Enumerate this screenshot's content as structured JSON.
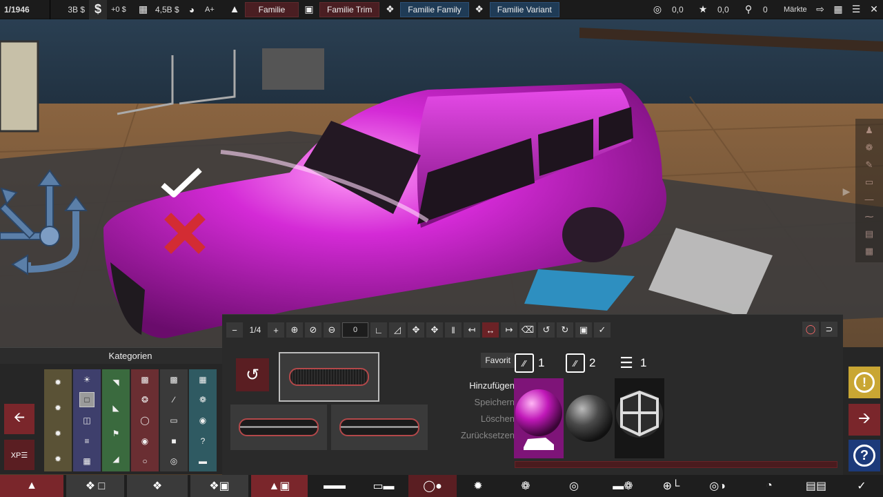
{
  "topbar": {
    "year": "1/1946",
    "money": "3B $",
    "money_icon": "dollar-icon",
    "delta": "+0 $",
    "cost": "4,5B $",
    "grade": "A+",
    "family_label": "Familie",
    "trim_label": "Familie Trim",
    "family_family_label": "Familie Family",
    "variant_label": "Familie Variant",
    "score1": "0,0",
    "score2": "0,0",
    "trophies": "0",
    "markets_label": "Märkte"
  },
  "categories": {
    "title": "Kategorien",
    "column_colors": [
      "#5a5236",
      "#3e3f6c",
      "#3a6a3e",
      "#6a2e32",
      "#3a3a3a",
      "#2f5a62"
    ]
  },
  "toolbar": {
    "page_indicator": "1/4",
    "value_input": "0"
  },
  "material": {
    "favorite_label": "Favorit",
    "add_label": "Hinzufügen",
    "save_label": "Speichern",
    "delete_label": "Löschen",
    "reset_label": "Zurücksetzen",
    "tab1_count": "1",
    "tab2_count": "2",
    "tab3_count": "1"
  },
  "colors": {
    "accent_red": "#7a262b",
    "accent_blue": "#1f3b56",
    "warning_yellow": "#c9a633",
    "help_blue": "#1c3a7a",
    "car_paint": "#c21ec4"
  }
}
